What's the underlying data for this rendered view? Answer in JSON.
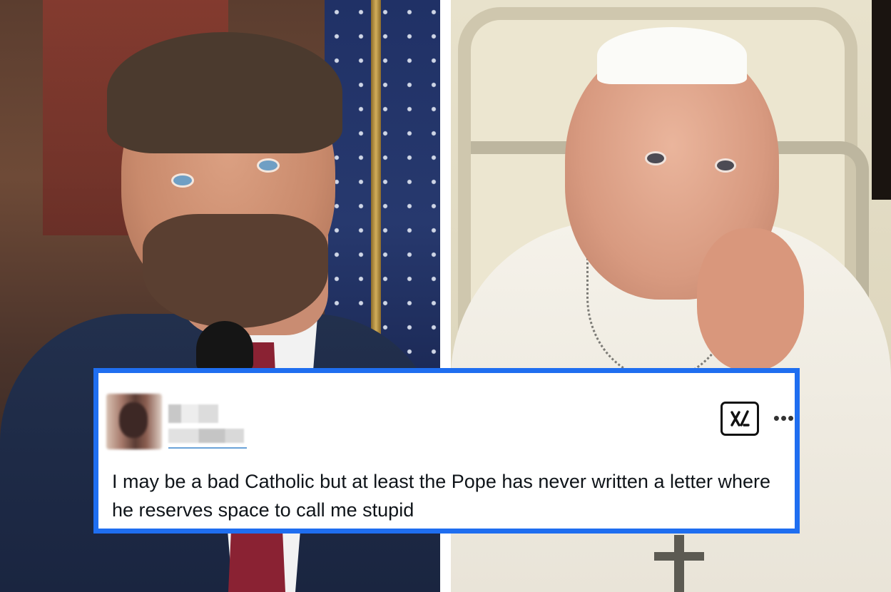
{
  "tweet": {
    "text": "I may be a bad Catholic but at least the Pope has never written a letter where he reserves space to call me stupid",
    "more_icon": "•••",
    "platform_icon": "x-logo-icon"
  },
  "colors": {
    "card_border": "#1f6ef0",
    "card_background": "#ffffff",
    "text": "#0f1419"
  }
}
